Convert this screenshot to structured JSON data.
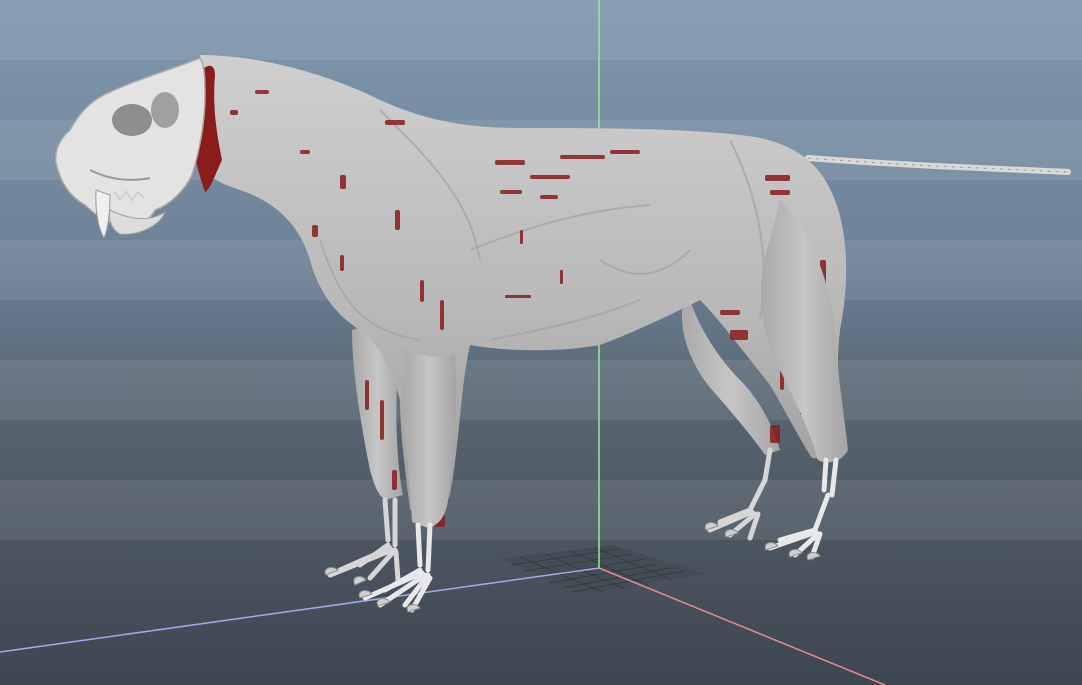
{
  "viewport": {
    "panel": "3d-perspective-viewport",
    "background_top": "#7f97ad",
    "background_bottom": "#3d4650",
    "grid_color": "#aeb8c4"
  },
  "axes": {
    "x_color": "#e58a8a",
    "y_color": "#8ff08f",
    "z_color": "#a7a7ee"
  },
  "model": {
    "subject": "sabertooth-cat-anatomy-model",
    "skin_color": "#b9b9b9",
    "muscle_color": "#8b1c1c",
    "bone_color": "#e6e6e6"
  }
}
